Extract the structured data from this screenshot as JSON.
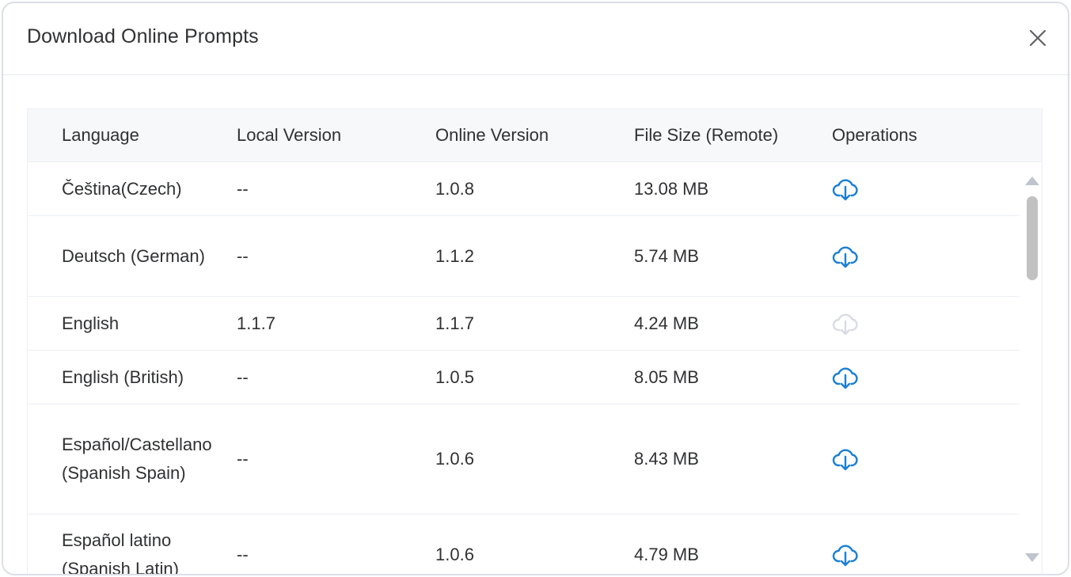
{
  "dialog": {
    "title": "Download Online Prompts"
  },
  "table": {
    "headers": {
      "language": "Language",
      "local_version": "Local Version",
      "online_version": "Online Version",
      "file_size": "File Size (Remote)",
      "operations": "Operations"
    },
    "rows": [
      {
        "language": "Čeština(Czech)",
        "local_version": "--",
        "online_version": "1.0.8",
        "file_size": "13.08 MB",
        "download_enabled": true
      },
      {
        "language": "Deutsch (German)",
        "local_version": "--",
        "online_version": "1.1.2",
        "file_size": "5.74 MB",
        "download_enabled": true
      },
      {
        "language": "English",
        "local_version": "1.1.7",
        "online_version": "1.1.7",
        "file_size": "4.24 MB",
        "download_enabled": false
      },
      {
        "language": "English (British)",
        "local_version": "--",
        "online_version": "1.0.5",
        "file_size": "8.05 MB",
        "download_enabled": true
      },
      {
        "language": "Español/Castellano (Spanish Spain)",
        "local_version": "--",
        "online_version": "1.0.6",
        "file_size": "8.43 MB",
        "download_enabled": true
      },
      {
        "language": "Español latino (Spanish Latin)",
        "local_version": "--",
        "online_version": "1.0.6",
        "file_size": "4.79 MB",
        "download_enabled": true
      }
    ]
  },
  "colors": {
    "accent": "#1a7fd4",
    "disabled": "#d9dce2"
  },
  "icons": {
    "close": "close-icon",
    "download": "cloud-download-icon"
  }
}
